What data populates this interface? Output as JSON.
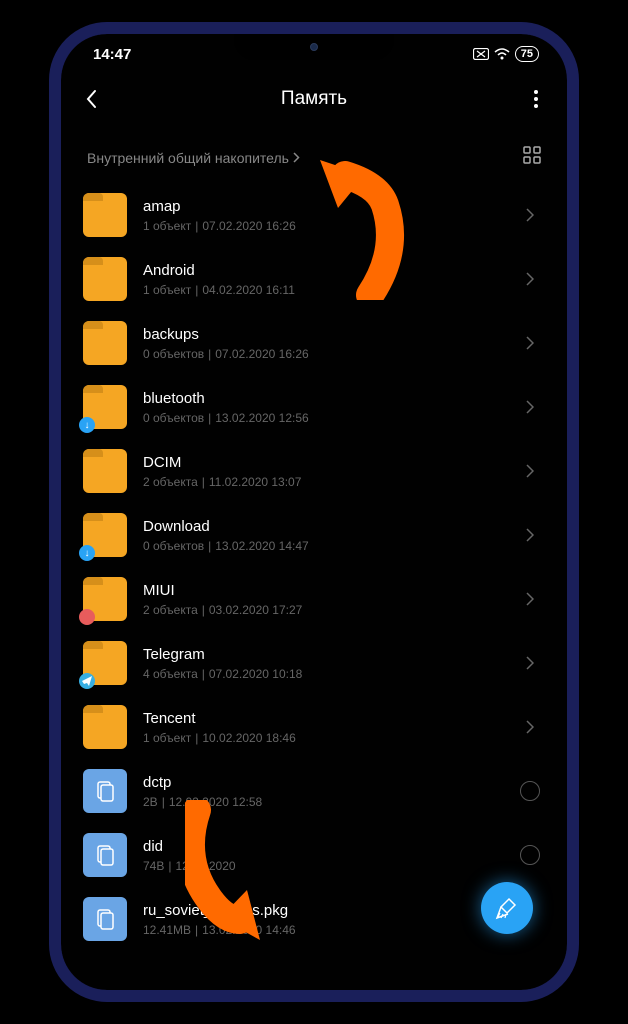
{
  "status_bar": {
    "time": "14:47",
    "battery": "75"
  },
  "header": {
    "title": "Память"
  },
  "breadcrumb": {
    "label": "Внутренний общий накопитель"
  },
  "items": [
    {
      "name": "amap",
      "meta1": "1 объект",
      "meta2": "07.02.2020 16:26",
      "type": "folder",
      "badge": "",
      "action": "chevron"
    },
    {
      "name": "Android",
      "meta1": "1 объект",
      "meta2": "04.02.2020 16:11",
      "type": "folder",
      "badge": "",
      "action": "chevron"
    },
    {
      "name": "backups",
      "meta1": "0 объектов",
      "meta2": "07.02.2020 16:26",
      "type": "folder",
      "badge": "",
      "action": "chevron"
    },
    {
      "name": "bluetooth",
      "meta1": "0 объектов",
      "meta2": "13.02.2020 12:56",
      "type": "folder",
      "badge": "blue",
      "action": "chevron"
    },
    {
      "name": "DCIM",
      "meta1": "2 объекта",
      "meta2": "11.02.2020 13:07",
      "type": "folder",
      "badge": "",
      "action": "chevron"
    },
    {
      "name": "Download",
      "meta1": "0 объектов",
      "meta2": "13.02.2020 14:47",
      "type": "folder",
      "badge": "blue",
      "action": "chevron"
    },
    {
      "name": "MIUI",
      "meta1": "2 объекта",
      "meta2": "03.02.2020 17:27",
      "type": "folder",
      "badge": "red",
      "action": "chevron"
    },
    {
      "name": "Telegram",
      "meta1": "4 объекта",
      "meta2": "07.02.2020 10:18",
      "type": "folder",
      "badge": "telegram",
      "action": "chevron"
    },
    {
      "name": "Tencent",
      "meta1": "1 объект",
      "meta2": "10.02.2020 18:46",
      "type": "folder",
      "badge": "",
      "action": "chevron"
    },
    {
      "name": "dctp",
      "meta1": "2B",
      "meta2": "12.02.2020 12:58",
      "type": "file",
      "badge": "",
      "action": "radio"
    },
    {
      "name": "did",
      "meta1": "74B",
      "meta2": "12.02.2020",
      "type": "file",
      "badge": "",
      "action": "radio"
    },
    {
      "name": "ru_soviet_movies.pkg",
      "meta1": "12.41MB",
      "meta2": "13.02.2020 14:46",
      "type": "file",
      "badge": "",
      "action": "none"
    }
  ]
}
